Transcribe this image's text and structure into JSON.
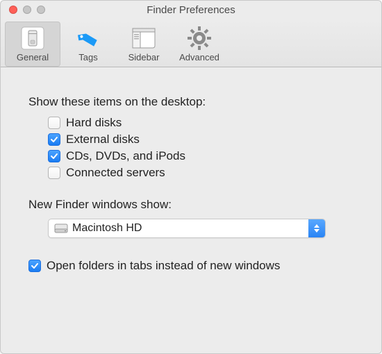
{
  "window": {
    "title": "Finder Preferences"
  },
  "toolbar": {
    "general": "General",
    "tags": "Tags",
    "sidebar": "Sidebar",
    "advanced": "Advanced",
    "selected": "general"
  },
  "desktop": {
    "heading": "Show these items on the desktop:",
    "items": [
      {
        "label": "Hard disks",
        "checked": false
      },
      {
        "label": "External disks",
        "checked": true
      },
      {
        "label": "CDs, DVDs, and iPods",
        "checked": true
      },
      {
        "label": "Connected servers",
        "checked": false
      }
    ]
  },
  "newWindow": {
    "heading": "New Finder windows show:",
    "selected": "Macintosh HD"
  },
  "tabs": {
    "label": "Open folders in tabs instead of new windows",
    "checked": true
  }
}
